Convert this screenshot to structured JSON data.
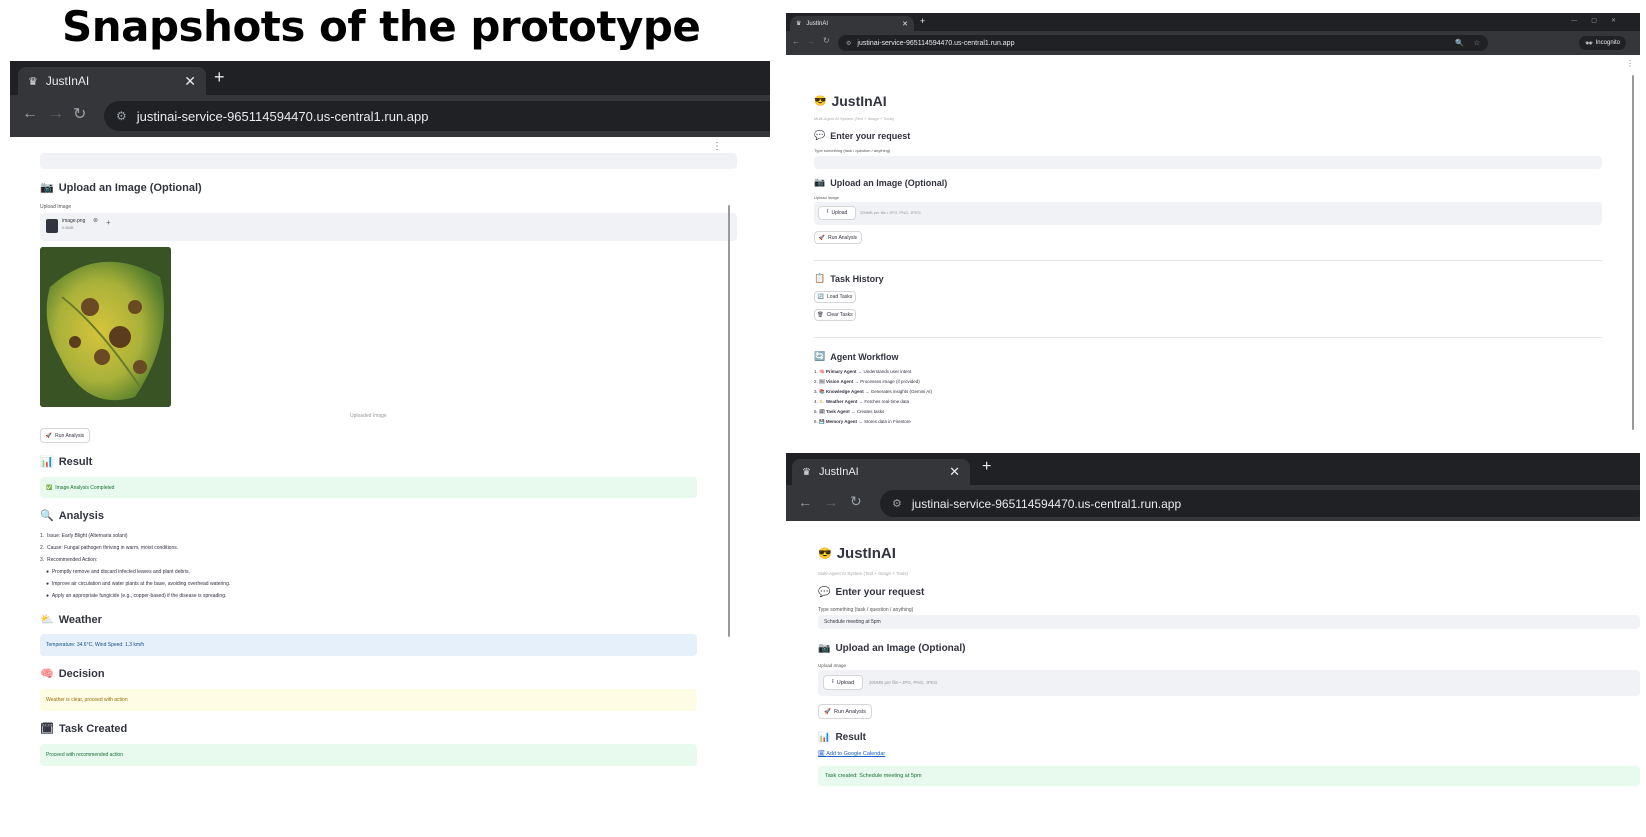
{
  "slide": {
    "title": "Snapshots of the prototype"
  },
  "icons": {
    "favicon": "crown-icon",
    "close": "close-icon",
    "newtab": "plus-icon",
    "back": "back-arrow-icon",
    "forward": "forward-arrow-icon",
    "reload": "reload-icon",
    "site_settings": "tune-icon",
    "menu": "kebab-menu-icon"
  },
  "colors": {
    "success_bg": "#e8f9ee",
    "info_bg": "#e6f0fb",
    "warning_bg": "#fffce5",
    "chrome_dark": "#202124"
  },
  "left": {
    "tab_title": "JustInAI",
    "url": "justinai-service-965114594470.us-central1.run.app",
    "upload_heading": "Upload an Image (Optional)",
    "upload_label": "Upload Image",
    "file_name": "image.png",
    "file_size": "0.6MB",
    "caption": "Uploaded Image",
    "run_button": "Run Analysis",
    "result_heading": "Result",
    "result_status": "Image Analysis Completed",
    "analysis_heading": "Analysis",
    "analysis_items": [
      "Issue: Early Blight (Alternaria solani)",
      "Cause: Fungal pathogen thriving in warm, moist conditions.",
      "Recommended Action:"
    ],
    "analysis_bullets": [
      "Promptly remove and discard infected leaves and plant debris.",
      "Improve air circulation and water plants at the base, avoiding overhead watering.",
      "Apply an appropriate fungicide (e.g., copper-based) if the disease is spreading."
    ],
    "weather_heading": "Weather",
    "weather_text": "Temperature: 34.6°C, Wind Speed: 1.3 km/h",
    "decision_heading": "Decision",
    "decision_text": "Weather is clear, proceed with action",
    "task_heading": "Task Created",
    "task_text": "Proceed with recommended action"
  },
  "top_right": {
    "tab_title": "JustInAI",
    "url": "justinai-service-965114594470.us-central1.run.app",
    "incognito_label": "Incognito",
    "app_title": "JustInAI",
    "subtitle": "Multi-Agent AI System (Text + Image + Tools)",
    "request_heading": "Enter your request",
    "request_label": "Type something (task / question / anything)",
    "upload_heading": "Upload an Image (Optional)",
    "upload_label": "Upload Image",
    "upload_button": "Upload",
    "upload_hint": "200MB per file • JPG, PNG, JPEG",
    "run_button": "Run Analysis",
    "history_heading": "Task History",
    "load_button": "Load Tasks",
    "clear_button": "Clear Tasks",
    "workflow_heading": "Agent Workflow",
    "workflow": [
      {
        "n": "1.",
        "name": "Primary Agent",
        "desc": "→ Understands user intent"
      },
      {
        "n": "2.",
        "name": "Vision Agent",
        "desc": "→ Processes image (if provided)"
      },
      {
        "n": "3.",
        "name": "Knowledge Agent",
        "desc": "→ Generates insights (Gemini AI)"
      },
      {
        "n": "4.",
        "name": "Weather Agent",
        "desc": "→ Fetches real-time data"
      },
      {
        "n": "5.",
        "name": "Task Agent",
        "desc": "→ Creates tasks"
      },
      {
        "n": "6.",
        "name": "Memory Agent",
        "desc": "→ Stores data in Firestore"
      }
    ]
  },
  "bottom_right": {
    "tab_title": "JustInAI",
    "url": "justinai-service-965114594470.us-central1.run.app",
    "app_title": "JustInAI",
    "subtitle": "Multi-Agent AI System (Text + Image + Tools)",
    "request_heading": "Enter your request",
    "request_label": "Type something (task / question / anything)",
    "request_value": "Schedule meeting at 5pm",
    "upload_heading": "Upload an Image (Optional)",
    "upload_label": "Upload Image",
    "upload_button": "Upload",
    "upload_hint": "200MB per file • JPG, PNG, JPEG",
    "run_button": "Run Analysis",
    "result_heading": "Result",
    "calendar_link": "Add to Google Calendar",
    "task_created": "Task created: Schedule meeting at 5pm"
  }
}
